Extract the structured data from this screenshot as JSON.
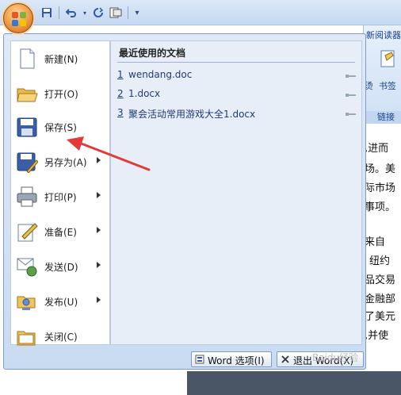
{
  "quick_access": {
    "icons": [
      "save-icon",
      "undo-icon",
      "redo-icon",
      "customize-icon"
    ]
  },
  "ribbon": {
    "tab_fragment": "新阅读器",
    "frag_left": "烫",
    "frag_right": "书签",
    "group_fragment": "链接"
  },
  "document": {
    "lines": [
      ",进而",
      "场。美",
      "际市场",
      "事项。",
      "来自",
      "纽约",
      "品交易",
      "金融部",
      "了美元",
      ",并使"
    ]
  },
  "menu": {
    "items": [
      {
        "label": "新建(N)",
        "icon": "new-document-icon",
        "submenu": false
      },
      {
        "label": "打开(O)",
        "icon": "open-folder-icon",
        "submenu": false
      },
      {
        "label": "保存(S)",
        "icon": "save-icon",
        "submenu": false
      },
      {
        "label": "另存为(A)",
        "icon": "save-as-icon",
        "submenu": true
      },
      {
        "label": "打印(P)",
        "icon": "print-icon",
        "submenu": true
      },
      {
        "label": "准备(E)",
        "icon": "prepare-icon",
        "submenu": true
      },
      {
        "label": "发送(D)",
        "icon": "send-icon",
        "submenu": true
      },
      {
        "label": "发布(U)",
        "icon": "publish-icon",
        "submenu": true
      },
      {
        "label": "关闭(C)",
        "icon": "close-folder-icon",
        "submenu": false
      }
    ],
    "recent_title": "最近使用的文档",
    "recent": [
      {
        "num": "1",
        "name": "wendang.doc"
      },
      {
        "num": "2",
        "name": "1.docx"
      },
      {
        "num": "3",
        "name": "聚会活动常用游戏大全1.docx"
      }
    ],
    "options_button": "Word 选项(I)",
    "exit_button": "退出 Word(X)"
  },
  "watermark": "Baidu经验",
  "colors": {
    "accent_arrow": "#e03a3a",
    "menu_bg": "#c9dbf1",
    "orb": "#f3a34b"
  }
}
